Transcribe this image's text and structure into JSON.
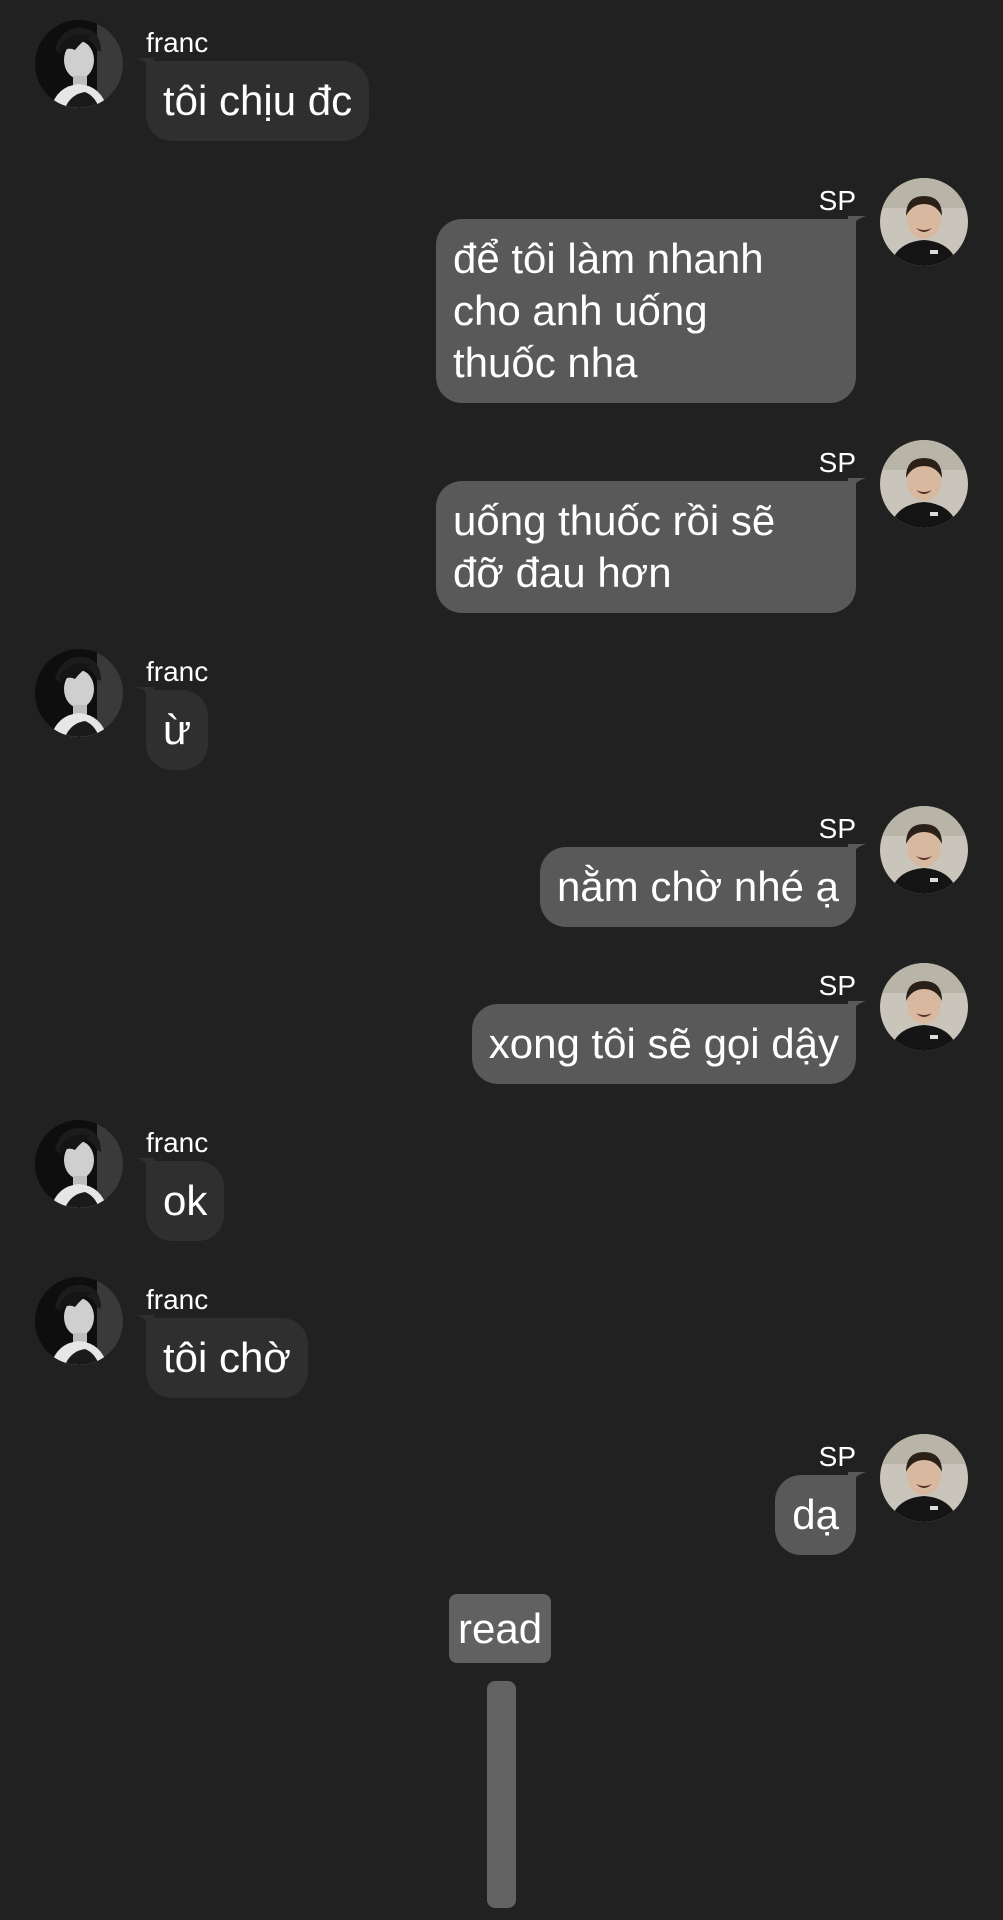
{
  "participants": {
    "franc": {
      "name": "franc",
      "avatar_icon": "franc-avatar-icon"
    },
    "sp": {
      "name": "SP",
      "avatar_icon": "sp-avatar-icon"
    }
  },
  "colors": {
    "background": "#212121",
    "incoming_bubble": "#2f2f2f",
    "outgoing_bubble": "#595959",
    "read_badge": "#616161",
    "scroll_handle": "#626262",
    "text": "#ffffff"
  },
  "messages": [
    {
      "side": "left",
      "sender": "franc",
      "text": "tôi chịu đc"
    },
    {
      "side": "right",
      "sender": "SP",
      "line1": "để tôi làm nhanh",
      "line2": "cho anh uống",
      "line3": "thuốc nha"
    },
    {
      "side": "right",
      "sender": "SP",
      "line1": "uống thuốc rồi sẽ",
      "line2": "đỡ đau hơn"
    },
    {
      "side": "left",
      "sender": "franc",
      "text": "ừ"
    },
    {
      "side": "right",
      "sender": "SP",
      "text": "nằm chờ nhé ạ"
    },
    {
      "side": "right",
      "sender": "SP",
      "text": "xong tôi sẽ gọi dậy"
    },
    {
      "side": "left",
      "sender": "franc",
      "text": "ok"
    },
    {
      "side": "left",
      "sender": "franc",
      "text": "tôi chờ"
    },
    {
      "side": "right",
      "sender": "SP",
      "text": "dạ"
    }
  ],
  "status": {
    "read_label": "read"
  }
}
